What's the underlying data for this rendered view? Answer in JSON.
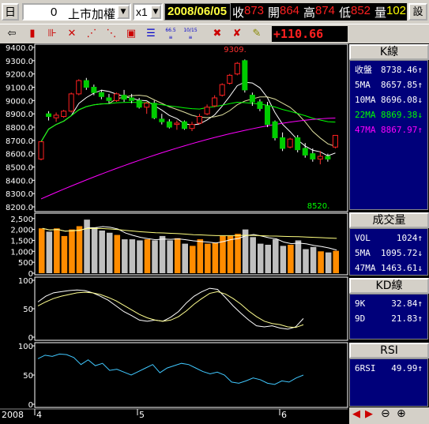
{
  "header": {
    "period_label": "日",
    "symbol_code": "0",
    "symbol_name": "上市加權",
    "multiplier": "x1",
    "date": "2008/06/05",
    "quote": [
      {
        "label": "收",
        "value": "873",
        "label_color": "#ffffff",
        "value_color": "#ff2020"
      },
      {
        "label": "開",
        "value": "864",
        "label_color": "#ffffff",
        "value_color": "#ff2020"
      },
      {
        "label": "高",
        "value": "874",
        "label_color": "#ffffff",
        "value_color": "#ff2020"
      },
      {
        "label": "低",
        "value": "852",
        "label_color": "#ffffff",
        "value_color": "#ff2020"
      },
      {
        "label": "量",
        "value": "102",
        "label_color": "#ffffff",
        "value_color": "#ffff00"
      }
    ],
    "corner_button": "設"
  },
  "toolbar": {
    "change_value": "+110.66",
    "change_color": "#ff2020",
    "icons": [
      "door-exit-icon",
      "candle-icon",
      "bar-icon",
      "cross-icon",
      "fan-icon",
      "fan-2-icon",
      "box-icon",
      "lines-icon",
      "gauge-66-icon",
      "gauge-10-icon",
      "delete-x-icon",
      "delete-all-icon",
      "pencil-icon"
    ],
    "small_labels": [
      "66.5",
      "10/15"
    ]
  },
  "kline": {
    "title": "K線",
    "peak_label": "9309.",
    "low_label": "8520.",
    "y_ticks": [
      "9400.0",
      "9300.0",
      "9200.0",
      "9100.0",
      "9000.0",
      "8900.0",
      "8800.0",
      "8700.0",
      "8600.0",
      "8500.0",
      "8400.0",
      "8300.0",
      "8200.0"
    ],
    "rows": [
      {
        "label": "收盤",
        "value": "8738.46",
        "arrow": "↑",
        "color": "#ffffff"
      },
      {
        "label": "5MA",
        "value": "8657.85",
        "arrow": "↑",
        "color": "#ffffff"
      },
      {
        "label": "10MA",
        "value": "8696.08",
        "arrow": "↓",
        "color": "#ffffff"
      },
      {
        "label": "22MA",
        "value": "8869.38",
        "arrow": "↓",
        "color": "#00ff00"
      },
      {
        "label": "47MA",
        "value": "8867.97",
        "arrow": "↑",
        "color": "#ff00ff"
      }
    ]
  },
  "volume": {
    "title": "成交量",
    "y_ticks": [
      "2,500",
      "2,000",
      "1,500",
      "1,000",
      "500",
      "0"
    ],
    "rows": [
      {
        "label": "VOL",
        "value": "1024",
        "arrow": "↑",
        "color": "#ffffff"
      },
      {
        "label": "5MA",
        "value": "1095.72",
        "arrow": "↓",
        "color": "#ffffff"
      },
      {
        "label": "47MA",
        "value": "1463.61",
        "arrow": "↓",
        "color": "#ffffff"
      }
    ]
  },
  "kd": {
    "title": "KD線",
    "y_ticks": [
      "100",
      "50",
      "0"
    ],
    "rows": [
      {
        "label": "9K",
        "value": "32.84",
        "arrow": "↑",
        "color": "#ffffff"
      },
      {
        "label": "9D",
        "value": "21.83",
        "arrow": "↑",
        "color": "#ffffff"
      }
    ]
  },
  "rsi": {
    "title": "RSI",
    "y_ticks": [
      "100",
      "50",
      "0"
    ],
    "rows": [
      {
        "label": "6RSI",
        "value": "49.99",
        "arrow": "↑",
        "color": "#ffffff"
      }
    ]
  },
  "time_axis": {
    "year": "2008",
    "months": [
      "4",
      "5",
      "6"
    ]
  },
  "chart_data": [
    {
      "type": "candlestick",
      "ylim": [
        8200,
        9400
      ],
      "ohlc": [
        [
          8560,
          8690,
          8550,
          8690
        ],
        [
          8900,
          8920,
          8850,
          8880
        ],
        [
          8870,
          8910,
          8840,
          8890
        ],
        [
          8880,
          8930,
          8870,
          8920
        ],
        [
          8920,
          9060,
          8910,
          9050
        ],
        [
          9050,
          9160,
          9040,
          9150
        ],
        [
          9150,
          9170,
          9080,
          9100
        ],
        [
          9100,
          9120,
          9040,
          9060
        ],
        [
          9060,
          9080,
          9010,
          9030
        ],
        [
          9020,
          9050,
          8980,
          9000
        ],
        [
          9000,
          9060,
          8990,
          9050
        ],
        [
          9040,
          9080,
          8990,
          9010
        ],
        [
          9020,
          9050,
          8980,
          9000
        ],
        [
          9000,
          9020,
          8940,
          8950
        ],
        [
          8950,
          8990,
          8900,
          8980
        ],
        [
          8980,
          9000,
          8860,
          8870
        ],
        [
          8860,
          8900,
          8820,
          8840
        ],
        [
          8840,
          8860,
          8790,
          8800
        ],
        [
          8820,
          8850,
          8780,
          8830
        ],
        [
          8840,
          8850,
          8780,
          8790
        ],
        [
          8790,
          8840,
          8770,
          8820
        ],
        [
          8830,
          8900,
          8820,
          8880
        ],
        [
          8900,
          8970,
          8890,
          8950
        ],
        [
          8960,
          9040,
          8950,
          9020
        ],
        [
          9040,
          9130,
          9030,
          9120
        ],
        [
          9130,
          9200,
          9120,
          9190
        ],
        [
          9200,
          9290,
          9190,
          9280
        ],
        [
          9300,
          9309,
          9060,
          9080
        ],
        [
          9040,
          9060,
          8960,
          8990
        ],
        [
          8990,
          9010,
          8920,
          8940
        ],
        [
          8960,
          8990,
          8800,
          8820
        ],
        [
          8840,
          8850,
          8700,
          8720
        ],
        [
          8720,
          8760,
          8620,
          8640
        ],
        [
          8650,
          8720,
          8640,
          8710
        ],
        [
          8720,
          8740,
          8610,
          8630
        ],
        [
          8640,
          8680,
          8570,
          8590
        ],
        [
          8600,
          8640,
          8540,
          8560
        ],
        [
          8560,
          8620,
          8520,
          8580
        ],
        [
          8580,
          8600,
          8540,
          8560
        ],
        [
          8650,
          8740,
          8640,
          8738
        ]
      ]
    },
    {
      "type": "bar",
      "series": [
        {
          "name": "VOL",
          "values": [
            2050,
            1900,
            2050,
            1700,
            2000,
            2150,
            2450,
            2100,
            1950,
            1850,
            1750,
            1550,
            1550,
            1500,
            1550,
            1500,
            1700,
            1500,
            1600,
            1350,
            1250,
            1550,
            1350,
            1400,
            1700,
            1700,
            1800,
            2000,
            1650,
            1350,
            1300,
            1550,
            1250,
            1300,
            1500,
            1100,
            1200,
            1000,
            950,
            1024
          ]
        }
      ]
    },
    {
      "type": "line",
      "series": [
        {
          "name": "9K",
          "values": [
            62,
            72,
            78,
            80,
            82,
            83,
            82,
            78,
            72,
            65,
            55,
            45,
            38,
            30,
            28,
            30,
            28,
            35,
            45,
            60,
            72,
            80,
            86,
            84,
            70,
            55,
            42,
            30,
            20,
            18,
            20,
            16,
            14,
            18,
            32.84
          ]
        },
        {
          "name": "9D",
          "values": [
            55,
            62,
            68,
            72,
            75,
            78,
            79,
            78,
            75,
            70,
            64,
            56,
            48,
            40,
            34,
            30,
            28,
            30,
            36,
            46,
            58,
            68,
            77,
            80,
            76,
            68,
            58,
            46,
            36,
            28,
            24,
            22,
            18,
            17,
            21.83
          ]
        }
      ]
    },
    {
      "type": "line",
      "series": [
        {
          "name": "6RSI",
          "values": [
            78,
            84,
            82,
            86,
            85,
            80,
            68,
            76,
            66,
            70,
            58,
            60,
            55,
            50,
            56,
            62,
            68,
            54,
            62,
            66,
            70,
            68,
            62,
            56,
            52,
            55,
            50,
            38,
            36,
            40,
            45,
            42,
            36,
            34,
            40,
            38,
            45,
            49.99
          ]
        }
      ]
    }
  ]
}
